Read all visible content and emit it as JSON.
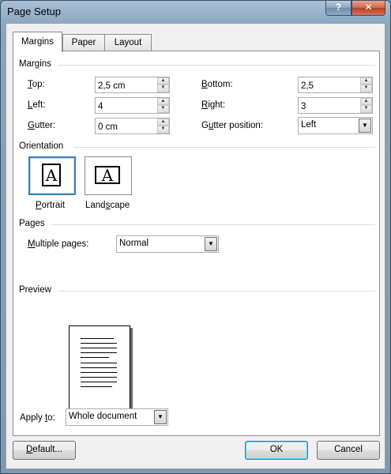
{
  "window": {
    "title": "Page Setup",
    "help_label": "?",
    "close_label": "✕"
  },
  "tabs": [
    {
      "label": "Margins",
      "active": true
    },
    {
      "label": "Paper",
      "active": false
    },
    {
      "label": "Layout",
      "active": false
    }
  ],
  "margins": {
    "section_label": "Margins",
    "top": {
      "label": "Top:",
      "value": "2,5 cm"
    },
    "left": {
      "label": "Left:",
      "value": "4"
    },
    "gutter": {
      "label": "Gutter:",
      "value": "0 cm"
    },
    "bottom": {
      "label": "Bottom:",
      "value": "2,5"
    },
    "right": {
      "label": "Right:",
      "value": "3"
    },
    "gutter_position": {
      "label": "Gutter position:",
      "value": "Left"
    }
  },
  "orientation": {
    "section_label": "Orientation",
    "portrait_label": "Portrait",
    "landscape_label": "Landscape",
    "glyph": "A",
    "selected": "portrait"
  },
  "pages": {
    "section_label": "Pages",
    "multiple_pages_label": "Multiple pages:",
    "multiple_pages_value": "Normal"
  },
  "preview": {
    "section_label": "Preview"
  },
  "apply_to": {
    "label": "Apply to:",
    "value": "Whole document"
  },
  "buttons": {
    "default": "Default...",
    "ok": "OK",
    "cancel": "Cancel"
  },
  "colors": {
    "accent": "#3c7fb1",
    "close": "#c8502f"
  }
}
